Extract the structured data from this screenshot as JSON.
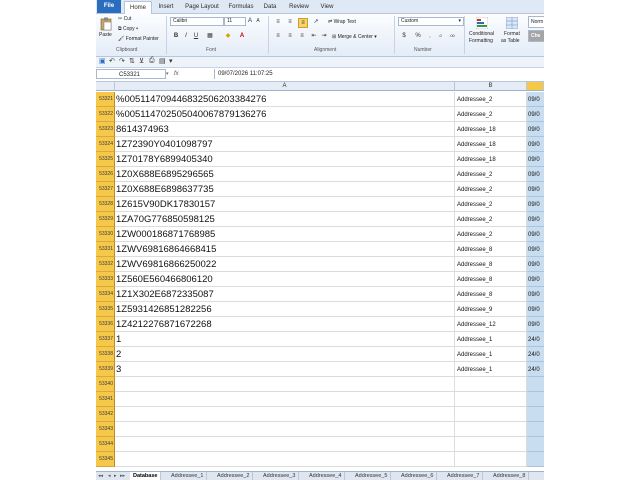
{
  "ribbon": {
    "tabs": [
      "File",
      "Home",
      "Insert",
      "Page Layout",
      "Formulas",
      "Data",
      "Review",
      "View"
    ],
    "clipboard": {
      "paste": "Paste",
      "cut": "Cut",
      "copy": "Copy",
      "format_painter": "Format Painter",
      "label": "Clipboard"
    },
    "font": {
      "name": "Calibri",
      "size": "11",
      "label": "Font",
      "bold": "B",
      "italic": "I",
      "underline": "U"
    },
    "alignment": {
      "wrap_text": "Wrap Text",
      "merge_center": "Merge & Center",
      "label": "Alignment"
    },
    "number": {
      "format": "Custom",
      "label": "Number"
    },
    "styles": {
      "conditional": "Conditional",
      "formatting": "Formatting",
      "format_as": "Format",
      "as_table": "as Table",
      "normal": "Norm",
      "check": "Che"
    }
  },
  "formula_bar": {
    "name_box": "C53321",
    "fx": "fx",
    "value": "09/07/2026  11:07:25"
  },
  "columns": {
    "a": "A",
    "b": "B"
  },
  "rows": [
    {
      "num": "53321",
      "a": "%0051147094468325062033842​76",
      "b": "Addressee_2",
      "c": "09/0"
    },
    {
      "num": "53322",
      "a": "%00511470250504006787913627​6",
      "b": "Addressee_2",
      "c": "09/0"
    },
    {
      "num": "53323",
      "a": "8614374963",
      "b": "Addressee_18",
      "c": "09/0"
    },
    {
      "num": "53324",
      "a": "1Z72390Y0401098797",
      "b": "Addressee_18",
      "c": "09/0"
    },
    {
      "num": "53325",
      "a": "1Z70178Y6899405340",
      "b": "Addressee_18",
      "c": "09/0"
    },
    {
      "num": "53326",
      "a": "1Z0X688E6895296565",
      "b": "Addressee_2",
      "c": "09/0"
    },
    {
      "num": "53327",
      "a": "1Z0X688E6898637735",
      "b": "Addressee_2",
      "c": "09/0"
    },
    {
      "num": "53328",
      "a": "1Z615V90DK17830157",
      "b": "Addressee_2",
      "c": "09/0"
    },
    {
      "num": "53329",
      "a": "1ZA70G776850598125",
      "b": "Addressee_2",
      "c": "09/0"
    },
    {
      "num": "53330",
      "a": "1ZW000186871768985",
      "b": "Addressee_2",
      "c": "09/0"
    },
    {
      "num": "53331",
      "a": "1ZWV69816864668415",
      "b": "Addressee_8",
      "c": "09/0"
    },
    {
      "num": "53332",
      "a": "1ZWV69816866250022",
      "b": "Addressee_8",
      "c": "09/0"
    },
    {
      "num": "53333",
      "a": "1Z560E560466806120",
      "b": "Addressee_8",
      "c": "09/0"
    },
    {
      "num": "53334",
      "a": "1Z1X302E6872335087",
      "b": "Addressee_8",
      "c": "09/0"
    },
    {
      "num": "53335",
      "a": "1Z5931426851282256",
      "b": "Addressee_9",
      "c": "09/0"
    },
    {
      "num": "53336",
      "a": "1Z4212276871672268",
      "b": "Addressee_12",
      "c": "09/0"
    },
    {
      "num": "53337",
      "a": "1",
      "b": "Addressee_1",
      "c": "24/0"
    },
    {
      "num": "53338",
      "a": "2",
      "b": "Addressee_1",
      "c": "24/0"
    },
    {
      "num": "53339",
      "a": "3",
      "b": "Addressee_1",
      "c": "24/0"
    },
    {
      "num": "53340",
      "a": "",
      "b": "",
      "c": ""
    },
    {
      "num": "53341",
      "a": "",
      "b": "",
      "c": ""
    },
    {
      "num": "53342",
      "a": "",
      "b": "",
      "c": ""
    },
    {
      "num": "53343",
      "a": "",
      "b": "",
      "c": ""
    },
    {
      "num": "53344",
      "a": "",
      "b": "",
      "c": ""
    },
    {
      "num": "53345",
      "a": "",
      "b": "",
      "c": ""
    }
  ],
  "sheets": [
    "Database",
    "Addressee_1",
    "Addressee_2",
    "Addressee_3",
    "Addressee_4",
    "Addressee_5",
    "Addressee_6",
    "Addressee_7",
    "Addressee_8"
  ],
  "colors": {
    "row_highlight": "#f6c84a",
    "selected_col": "#c9ddf0",
    "file_tab": "#2a6cbe"
  }
}
